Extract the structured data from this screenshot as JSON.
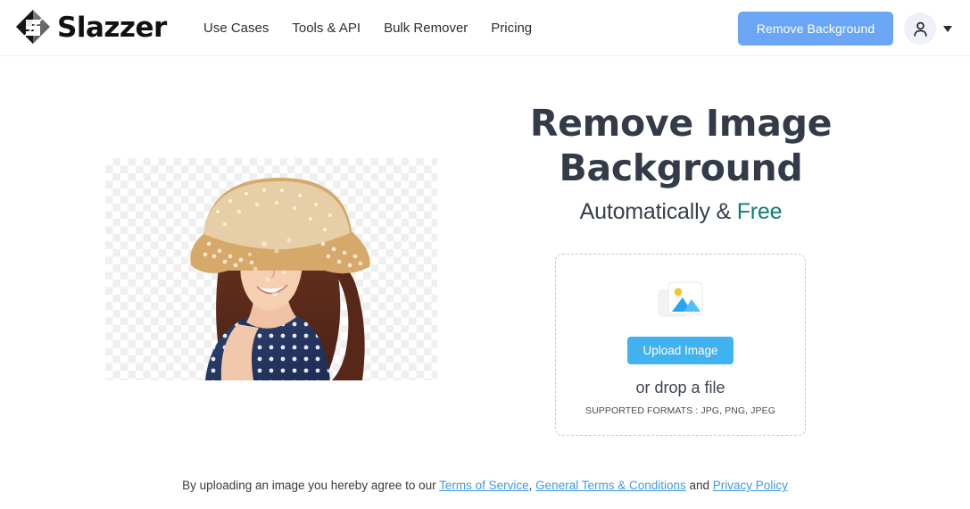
{
  "header": {
    "brand_name": "Slazzer",
    "brand_logo_icon": "slazzer-diamond-logo",
    "nav": [
      {
        "label": "Use Cases"
      },
      {
        "label": "Tools & API"
      },
      {
        "label": "Bulk Remover"
      },
      {
        "label": "Pricing"
      }
    ],
    "cta_label": "Remove Background",
    "cta_color": "#6aa6f5",
    "account_icon": "user-avatar-icon",
    "account_caret_icon": "chevron-down-icon"
  },
  "hero": {
    "title_line1": "Remove Image",
    "title_line2": "Background",
    "subtitle_prefix": "Automatically & ",
    "subtitle_accent": "Free",
    "accent_color": "#0a8077",
    "title_color": "#333b49"
  },
  "sample": {
    "alt": "Smiling woman in straw hat on transparent checkerboard background",
    "background": "transparency-checkerboard"
  },
  "dropzone": {
    "icon": "image-placeholder-icon",
    "upload_label": "Upload Image",
    "upload_color": "#41b2f0",
    "drop_text": "or drop a file",
    "formats_text": "SUPPORTED FORMATS : JPG, PNG, JPEG"
  },
  "footer": {
    "prefix": "By uploading an image you hereby agree to our ",
    "link_terms": "Terms of Service",
    "separator1": ", ",
    "link_general": "General Terms & Conditions",
    "separator2": " and ",
    "link_privacy": "Privacy Policy",
    "link_color": "#3d9ae8"
  }
}
